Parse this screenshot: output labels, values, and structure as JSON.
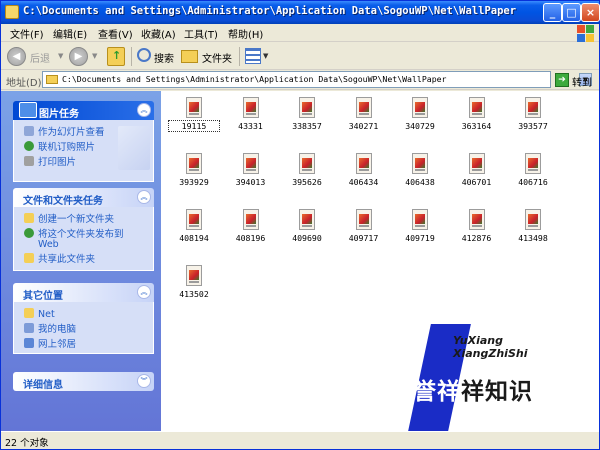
{
  "window": {
    "title": "C:\\Documents and Settings\\Administrator\\Application Data\\SogouWP\\Net\\WallPaper"
  },
  "menu": [
    "文件(F)",
    "编辑(E)",
    "查看(V)",
    "收藏(A)",
    "工具(T)",
    "帮助(H)"
  ],
  "toolbar": {
    "back": "后退",
    "search": "搜索",
    "folders": "文件夹"
  },
  "address": {
    "label": "地址(D)",
    "value": "C:\\Documents and Settings\\Administrator\\Application Data\\SogouWP\\Net\\WallPaper",
    "go": "转到"
  },
  "panels": {
    "picture_tasks": {
      "title": "图片任务",
      "items": [
        "作为幻灯片查看",
        "联机订购照片",
        "打印图片"
      ]
    },
    "file_tasks": {
      "title": "文件和文件夹任务",
      "items": [
        "创建一个新文件夹",
        "将这个文件夹发布到",
        "Web",
        "共享此文件夹"
      ]
    },
    "other_places": {
      "title": "其它位置",
      "items": [
        "Net",
        "我的电脑",
        "网上邻居"
      ]
    },
    "details": {
      "title": "详细信息"
    }
  },
  "files": [
    "19115",
    "43331",
    "338357",
    "340271",
    "340729",
    "363164",
    "393577",
    "393929",
    "394013",
    "395626",
    "406434",
    "406438",
    "406701",
    "406716",
    "408194",
    "408196",
    "409690",
    "409717",
    "409719",
    "412876",
    "413498",
    "413502"
  ],
  "status": {
    "count": "22 个对象"
  },
  "watermark": {
    "line1": "YuXiang",
    "line2": "XiangZhiShi",
    "cn1": "誉祥",
    "cn2": "祥知识"
  },
  "colors": {
    "titlebar": "#0054E3",
    "taskpane": "#6375D6",
    "link": "#215DC6"
  }
}
